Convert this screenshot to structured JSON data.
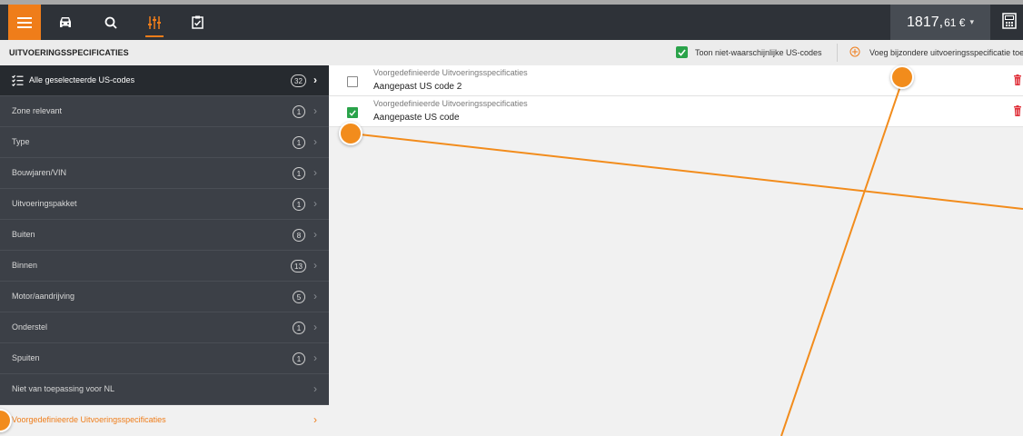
{
  "topbar": {
    "price_main": "1817,",
    "price_decimal": "61 €",
    "icons": [
      "menu-icon",
      "car-icon",
      "search-icon",
      "equalizer-icon",
      "clipboard-icon",
      "calculator-icon"
    ]
  },
  "subbar": {
    "title": "UITVOERINGSSPECIFICATIES",
    "toggle_label": "Toon niet-waarschijnlijke US-codes",
    "toggle_checked": true,
    "add_label": "Voeg bijzondere uitvoeringsspecificatie toe"
  },
  "sidebar": {
    "all": {
      "label": "Alle geselecteerde US-codes",
      "count": "32"
    },
    "items": [
      {
        "label": "Zone relevant",
        "count": "1"
      },
      {
        "label": "Type",
        "count": "1"
      },
      {
        "label": "Bouwjaren/VIN",
        "count": "1"
      },
      {
        "label": "Uitvoeringspakket",
        "count": "1"
      },
      {
        "label": "Buiten",
        "count": "8"
      },
      {
        "label": "Binnen",
        "count": "13"
      },
      {
        "label": "Motor/aandrijving",
        "count": "5"
      },
      {
        "label": "Onderstel",
        "count": "1"
      },
      {
        "label": "Spuiten",
        "count": "1"
      },
      {
        "label": "Niet van toepassing voor NL",
        "count": ""
      }
    ],
    "active": {
      "label": "Voorgedefinieerde Uitvoeringsspecificaties"
    }
  },
  "main": {
    "rows": [
      {
        "category": "Voorgedefinieerde Uitvoeringsspecificaties",
        "name": "Aangepast US code 2",
        "checked": false
      },
      {
        "category": "Voorgedefinieerde Uitvoeringsspecificaties",
        "name": "Aangepaste US code",
        "checked": true
      }
    ]
  },
  "colors": {
    "accent": "#ef7d1a",
    "topbar": "#2e3238",
    "sidebar": "#3c4047",
    "check_green": "#2aa34a",
    "trash_red": "#e0303a",
    "overlay_line": "#f28c1c"
  }
}
